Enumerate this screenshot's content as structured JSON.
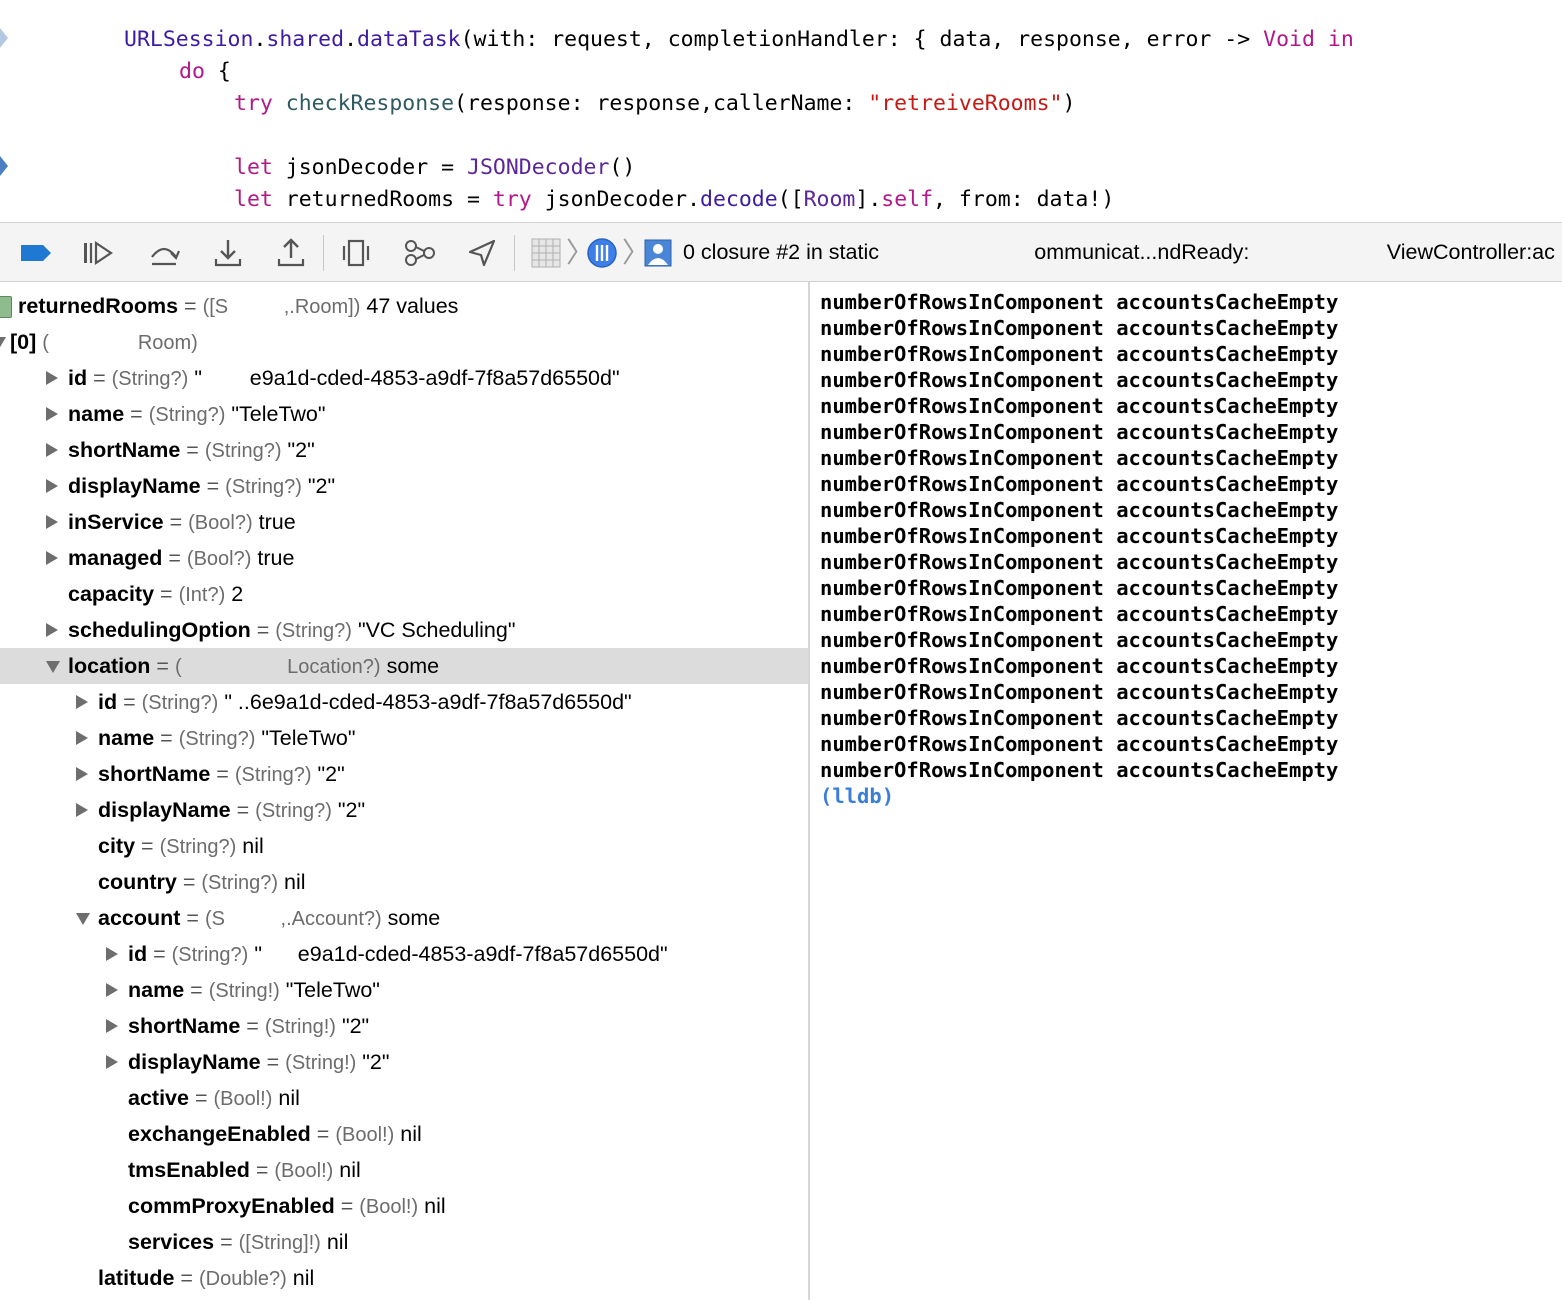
{
  "editor": {
    "lines": [
      {
        "tokens": [
          {
            "t": "URLSession",
            "c": "api"
          },
          {
            "t": ".",
            "c": ""
          },
          {
            "t": "shared",
            "c": "api"
          },
          {
            "t": ".",
            "c": ""
          },
          {
            "t": "dataTask",
            "c": "api"
          },
          {
            "t": "(with: request, completionHandler: { data, response, error -> ",
            "c": ""
          },
          {
            "t": "Void",
            "c": "kw"
          },
          {
            "t": " ",
            "c": ""
          },
          {
            "t": "in",
            "c": "kw"
          }
        ]
      },
      {
        "tokens": [
          {
            "t": "do",
            "c": "kw"
          },
          {
            "t": " {",
            "c": ""
          }
        ]
      },
      {
        "tokens": [
          {
            "t": "try",
            "c": "kw"
          },
          {
            "t": " ",
            "c": ""
          },
          {
            "t": "checkResponse",
            "c": "fn"
          },
          {
            "t": "(response: response,callerName: ",
            "c": ""
          },
          {
            "t": "\"retreiveRooms\"",
            "c": "str"
          },
          {
            "t": ")",
            "c": ""
          }
        ]
      },
      {
        "tokens": []
      },
      {
        "tokens": [
          {
            "t": "let",
            "c": "kw"
          },
          {
            "t": " jsonDecoder = ",
            "c": ""
          },
          {
            "t": "JSONDecoder",
            "c": "type"
          },
          {
            "t": "()",
            "c": ""
          }
        ]
      },
      {
        "tokens": [
          {
            "t": "let",
            "c": "kw"
          },
          {
            "t": " returnedRooms = ",
            "c": ""
          },
          {
            "t": "try",
            "c": "kw"
          },
          {
            "t": " jsonDecoder.",
            "c": ""
          },
          {
            "t": "decode",
            "c": "api"
          },
          {
            "t": "([",
            "c": ""
          },
          {
            "t": "Room",
            "c": "type"
          },
          {
            "t": "].",
            "c": ""
          },
          {
            "t": "self",
            "c": "kw"
          },
          {
            "t": ", from: data!)",
            "c": ""
          }
        ]
      }
    ]
  },
  "toolbar": {
    "frame_label": "0 closure #2 in static                          ommunicat...ndReady:                       ViewController:ac"
  },
  "variables": [
    {
      "indent": 0,
      "tri": "none",
      "icon": true,
      "name": "returnedRooms",
      "type": "([S          ,.Room])",
      "value": "47 values"
    },
    {
      "indent": 0,
      "tri": "down-partial",
      "name": "[0]",
      "type": "(                Room)",
      "value": ""
    },
    {
      "indent": 1,
      "tri": "right",
      "name": "id",
      "type": "(String?)",
      "value": "\"        e9a1d-cded-4853-a9df-7f8a57d6550d\""
    },
    {
      "indent": 1,
      "tri": "right",
      "name": "name",
      "type": "(String?)",
      "value": "\"TeleTwo\""
    },
    {
      "indent": 1,
      "tri": "right",
      "name": "shortName",
      "type": "(String?)",
      "value": "\"2\""
    },
    {
      "indent": 1,
      "tri": "right",
      "name": "displayName",
      "type": "(String?)",
      "value": "\"2\""
    },
    {
      "indent": 1,
      "tri": "right",
      "name": "inService",
      "type": "(Bool?)",
      "value": "true"
    },
    {
      "indent": 1,
      "tri": "right",
      "name": "managed",
      "type": "(Bool?)",
      "value": "true"
    },
    {
      "indent": 1,
      "tri": "none",
      "name": "capacity",
      "type": "(Int?)",
      "value": "2"
    },
    {
      "indent": 1,
      "tri": "right",
      "name": "schedulingOption",
      "type": "(String?)",
      "value": "\"VC Scheduling\""
    },
    {
      "indent": 1,
      "tri": "down",
      "selected": true,
      "name": "location",
      "type": "(                   Location?)",
      "value": "some"
    },
    {
      "indent": 2,
      "tri": "right",
      "name": "id",
      "type": "(String?)",
      "value": "\" ..6e9a1d-cded-4853-a9df-7f8a57d6550d\""
    },
    {
      "indent": 2,
      "tri": "right",
      "name": "name",
      "type": "(String?)",
      "value": "\"TeleTwo\""
    },
    {
      "indent": 2,
      "tri": "right",
      "name": "shortName",
      "type": "(String?)",
      "value": "\"2\""
    },
    {
      "indent": 2,
      "tri": "right",
      "name": "displayName",
      "type": "(String?)",
      "value": "\"2\""
    },
    {
      "indent": 2,
      "tri": "none",
      "name": "city",
      "type": "(String?)",
      "value": "nil"
    },
    {
      "indent": 2,
      "tri": "none",
      "name": "country",
      "type": "(String?)",
      "value": "nil"
    },
    {
      "indent": 2,
      "tri": "down",
      "name": "account",
      "type": "(S          ,.Account?)",
      "value": "some"
    },
    {
      "indent": 3,
      "tri": "right",
      "name": "id",
      "type": "(String?)",
      "value": "\"      e9a1d-cded-4853-a9df-7f8a57d6550d\""
    },
    {
      "indent": 3,
      "tri": "right",
      "name": "name",
      "type": "(String!)",
      "value": "\"TeleTwo\""
    },
    {
      "indent": 3,
      "tri": "right",
      "name": "shortName",
      "type": "(String!)",
      "value": "\"2\""
    },
    {
      "indent": 3,
      "tri": "right",
      "name": "displayName",
      "type": "(String!)",
      "value": "\"2\""
    },
    {
      "indent": 3,
      "tri": "none",
      "name": "active",
      "type": "(Bool!)",
      "value": "nil"
    },
    {
      "indent": 3,
      "tri": "none",
      "name": "exchangeEnabled",
      "type": "(Bool!)",
      "value": "nil"
    },
    {
      "indent": 3,
      "tri": "none",
      "name": "tmsEnabled",
      "type": "(Bool!)",
      "value": "nil"
    },
    {
      "indent": 3,
      "tri": "none",
      "name": "commProxyEnabled",
      "type": "(Bool!)",
      "value": "nil"
    },
    {
      "indent": 3,
      "tri": "none",
      "name": "services",
      "type": "([String]!)",
      "value": "nil"
    },
    {
      "indent": 2,
      "tri": "none",
      "name": "latitude",
      "type": "(Double?)",
      "value": "nil"
    }
  ],
  "console": {
    "log_lines": [
      "numberOfRowsInComponent accountsCacheEmpty",
      "numberOfRowsInComponent accountsCacheEmpty",
      "numberOfRowsInComponent accountsCacheEmpty",
      "numberOfRowsInComponent accountsCacheEmpty",
      "numberOfRowsInComponent accountsCacheEmpty",
      "numberOfRowsInComponent accountsCacheEmpty",
      "numberOfRowsInComponent accountsCacheEmpty",
      "numberOfRowsInComponent accountsCacheEmpty",
      "numberOfRowsInComponent accountsCacheEmpty",
      "numberOfRowsInComponent accountsCacheEmpty",
      "numberOfRowsInComponent accountsCacheEmpty",
      "numberOfRowsInComponent accountsCacheEmpty",
      "numberOfRowsInComponent accountsCacheEmpty",
      "numberOfRowsInComponent accountsCacheEmpty",
      "numberOfRowsInComponent accountsCacheEmpty",
      "numberOfRowsInComponent accountsCacheEmpty",
      "numberOfRowsInComponent accountsCacheEmpty",
      "numberOfRowsInComponent accountsCacheEmpty",
      "numberOfRowsInComponent accountsCacheEmpty"
    ],
    "prompt": "(lldb)"
  },
  "colors": {
    "keyword": "#b21889",
    "api": "#3e1ba3",
    "string": "#c41a16",
    "type": "#5c2699",
    "accent": "#1f78d1",
    "prompt": "#3b7ed7"
  },
  "icons": [
    "breakpoint-toggle-icon",
    "continue-icon",
    "step-over-icon",
    "step-into-icon",
    "step-out-icon",
    "view-hierarchy-icon",
    "memory-graph-icon",
    "location-icon",
    "thread-icon",
    "queue-icon",
    "frame-icon"
  ]
}
